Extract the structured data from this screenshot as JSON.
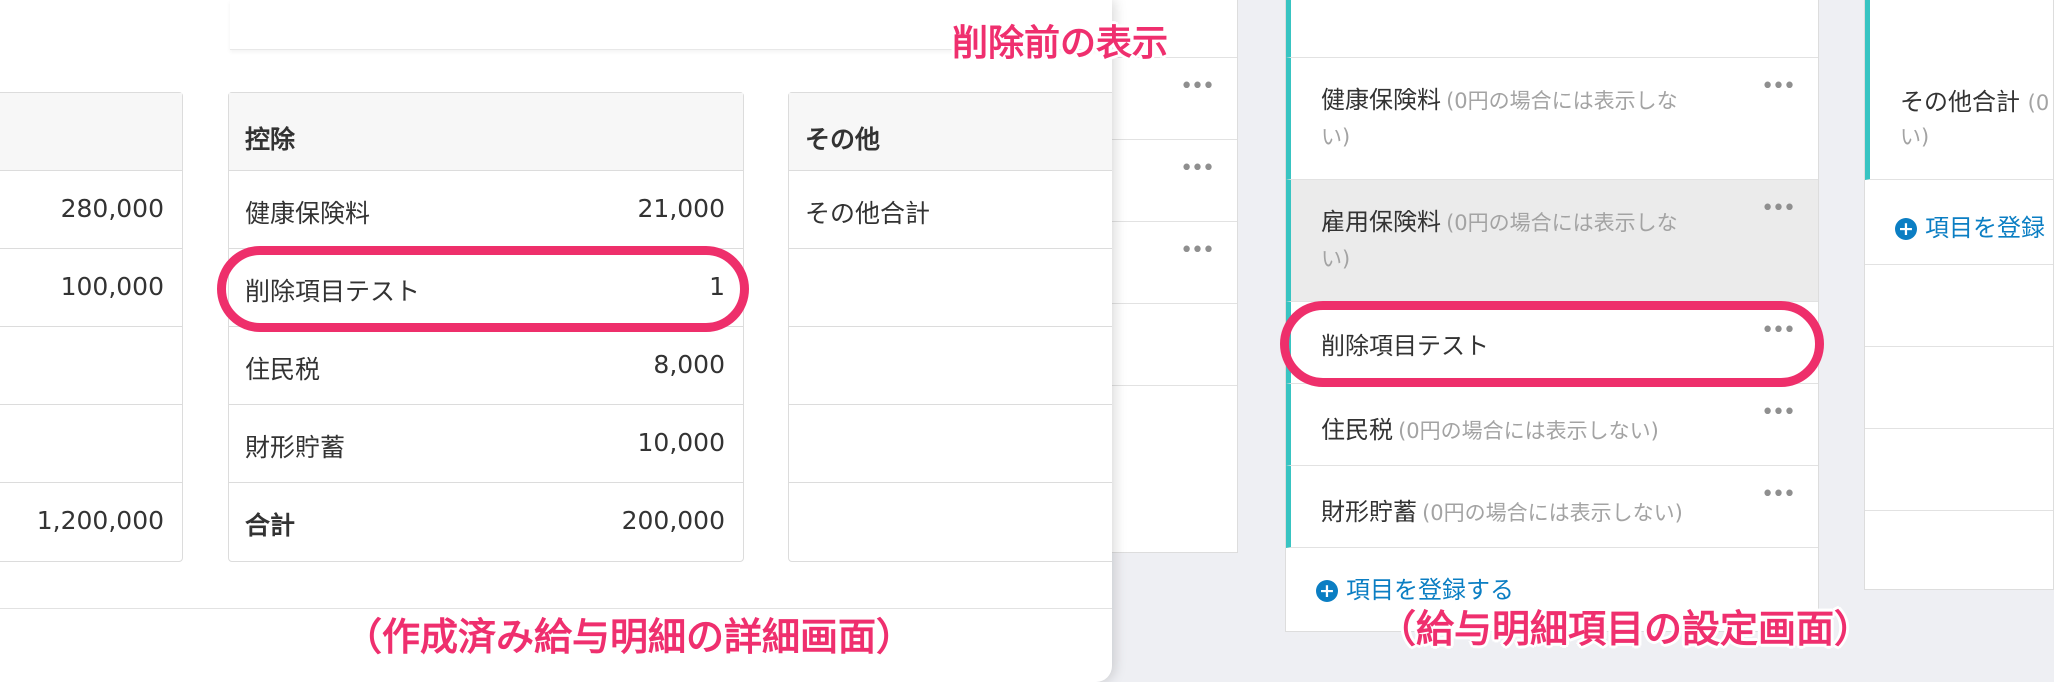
{
  "annotations": {
    "before_deletion": "削除前の表示",
    "detail_screen": "（作成済み給与明細の詳細画面）",
    "settings_screen": "（給与明細項目の設定画面）"
  },
  "earnings_table": {
    "values": [
      "280,000",
      "100,000",
      "",
      "",
      "1,200,000"
    ]
  },
  "deduction_table": {
    "header": "控除",
    "rows": [
      {
        "label": "健康保険料",
        "value": "21,000"
      },
      {
        "label": "削除項目テスト",
        "value": "1"
      },
      {
        "label": "住民税",
        "value": "8,000"
      },
      {
        "label": "財形貯蓄",
        "value": "10,000"
      }
    ],
    "total": {
      "label": "合計",
      "value": "200,000"
    }
  },
  "other_table": {
    "header": "その他",
    "rows": [
      {
        "label": "その他合計"
      }
    ]
  },
  "settings": {
    "deduction_items": [
      {
        "name": "健康保険料",
        "note_a": "(0円の場合には表示しな",
        "note_b": "い)"
      },
      {
        "name": "雇用保険料",
        "note_a": "(0円の場合には表示しな",
        "note_b": "い)"
      },
      {
        "name": "削除項目テスト",
        "note_a": "",
        "note_b": ""
      },
      {
        "name": "住民税",
        "note_a": "(0円の場合には表示しない)",
        "note_b": ""
      },
      {
        "name": "財形貯蓄",
        "note_a": "(0円の場合には表示しない)",
        "note_b": ""
      }
    ],
    "register_label": "項目を登録する",
    "other_items": [
      {
        "name": "その他合計",
        "note_a": "(0",
        "note_b": "い)"
      }
    ],
    "other_register_label": "項目を登録",
    "more_icon": "more-horizontal-icon",
    "accent_color": "#38c4c2",
    "link_color": "#0b7ec3",
    "highlight_color": "#ee2f6b"
  }
}
